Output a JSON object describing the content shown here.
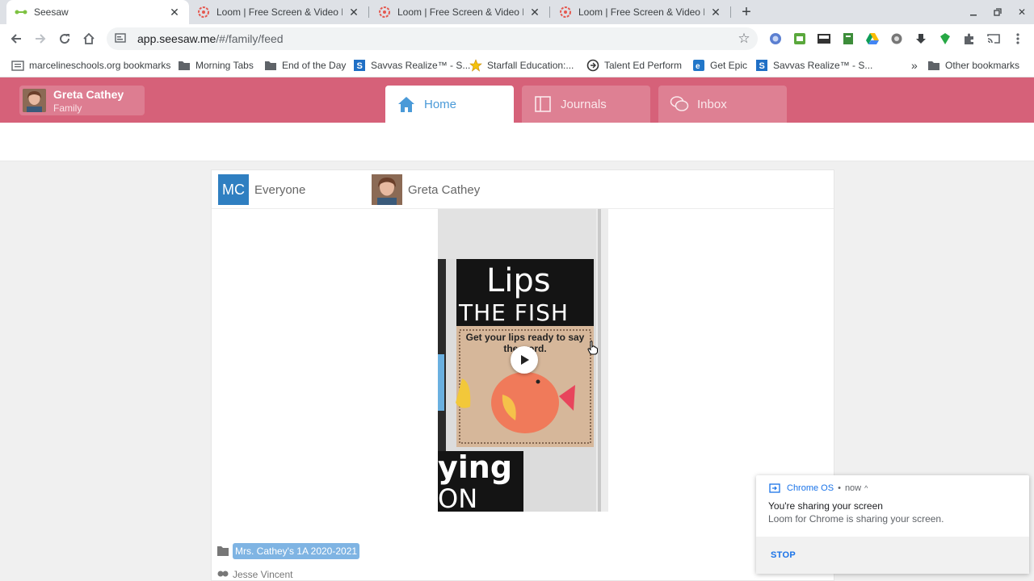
{
  "browser": {
    "tabs": [
      {
        "title": "Seesaw",
        "favicon": "seesaw-icon",
        "active": true
      },
      {
        "title": "Loom | Free Screen & Video Reco",
        "favicon": "loom-icon",
        "active": false
      },
      {
        "title": "Loom | Free Screen & Video Reco",
        "favicon": "loom-icon",
        "active": false
      },
      {
        "title": "Loom | Free Screen & Video Reco",
        "favicon": "loom-icon",
        "active": false
      }
    ],
    "url_host": "app.seesaw.me",
    "url_path": "/#/family/feed",
    "bookmarks": [
      {
        "label": "marcelineschools.org bookmarks",
        "icon": "bookmark-folder-icon"
      },
      {
        "label": "Morning Tabs",
        "icon": "folder-icon"
      },
      {
        "label": "End of the Day",
        "icon": "folder-icon"
      },
      {
        "label": "Savvas Realize™ - S...",
        "icon": "savvas-icon"
      },
      {
        "label": "Starfall Education:...",
        "icon": "starfall-icon"
      },
      {
        "label": "Talent Ed Perform",
        "icon": "talented-icon"
      },
      {
        "label": "Get Epic",
        "icon": "epic-icon"
      },
      {
        "label": "Savvas Realize™ - S...",
        "icon": "savvas-icon"
      }
    ],
    "bookmarks_overflow": "»",
    "other_bookmarks": "Other bookmarks"
  },
  "seesaw": {
    "user_name": "Greta Cathey",
    "user_role": "Family",
    "nav": {
      "home": "Home",
      "journals": "Journals",
      "inbox": "Inbox"
    },
    "brand_color": "#d66179",
    "accent_color": "#4a9ad8"
  },
  "post": {
    "audience_initials": "MC",
    "audience_label": "Everyone",
    "author_name": "Greta Cathey",
    "media_caption_title": "Lips",
    "media_caption_sub": "THE FISH",
    "media_caption_body": "Get your lips ready to say the word.",
    "media_bottom_text": "ying",
    "media_bottom_text2": "ON",
    "class_name": "Mrs. Cathey's 1A 2020-2021",
    "student_name": "Jesse Vincent"
  },
  "notification": {
    "source": "Chrome OS",
    "separator": "•",
    "time": "now",
    "title": "You're sharing your screen",
    "body": "Loom for Chrome is sharing your screen.",
    "action": "STOP"
  }
}
